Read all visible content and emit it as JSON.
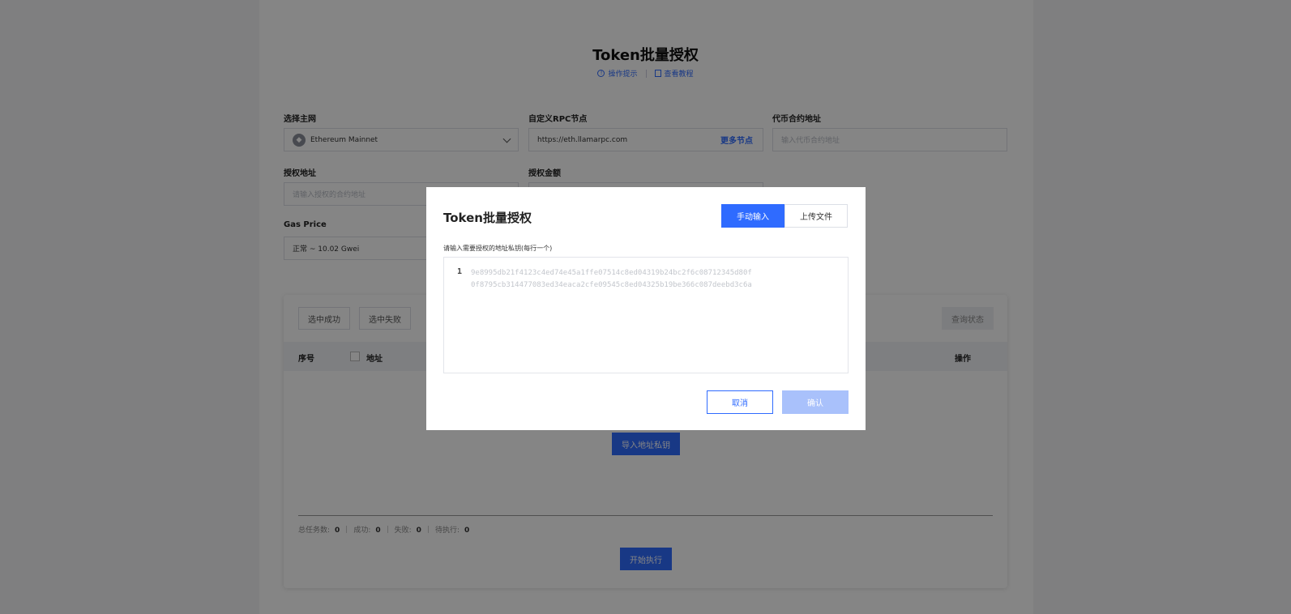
{
  "page": {
    "title": "Token批量授权",
    "links": {
      "tips": "操作提示",
      "tutorial": "查看教程"
    },
    "network": {
      "label": "选择主网",
      "value": "Ethereum Mainnet"
    },
    "rpc": {
      "label": "自定义RPC节点",
      "value": "https://eth.llamarpc.com",
      "more": "更多节点"
    },
    "contract": {
      "label": "代币合约地址",
      "placeholder": "输入代币合约地址"
    },
    "spender": {
      "label": "授权地址",
      "placeholder": "请输入授权的合约地址"
    },
    "amount": {
      "label": "授权金额"
    },
    "gas": {
      "label": "Gas Price",
      "value": "正常 ~ 10.02 Gwei"
    },
    "table": {
      "select_success": "选中成功",
      "select_fail": "选中失败",
      "query_status": "查询状态",
      "col_index": "序号",
      "col_address": "地址",
      "col_action": "操作",
      "import_button": "导入地址私钥",
      "stats": {
        "total_label": "总任务数:",
        "total": "0",
        "success_label": "成功:",
        "success": "0",
        "fail_label": "失败:",
        "fail": "0",
        "pending_label": "待执行:",
        "pending": "0"
      },
      "start_button": "开始执行"
    }
  },
  "modal": {
    "title": "Token批量授权",
    "tab_manual": "手动输入",
    "tab_upload": "上传文件",
    "prompt": "请输入需要授权的地址私钥(每行一个)",
    "line_number": "1",
    "placeholder_lines": "9e8995db21f4123c4ed74e45a1ffe07514c8ed04319b24bc2f6c08712345d80f\n0f8795cb314477083ed34eaca2cfe09545c8ed04325b19be366c087deebd3c6a",
    "cancel": "取消",
    "confirm": "确认"
  },
  "colors": {
    "accent": "#2f6bff",
    "confirm_disabled": "#a9c1fb"
  },
  "icons": [
    "info-icon",
    "doc-icon",
    "ethereum-icon",
    "chevron-down-icon"
  ]
}
